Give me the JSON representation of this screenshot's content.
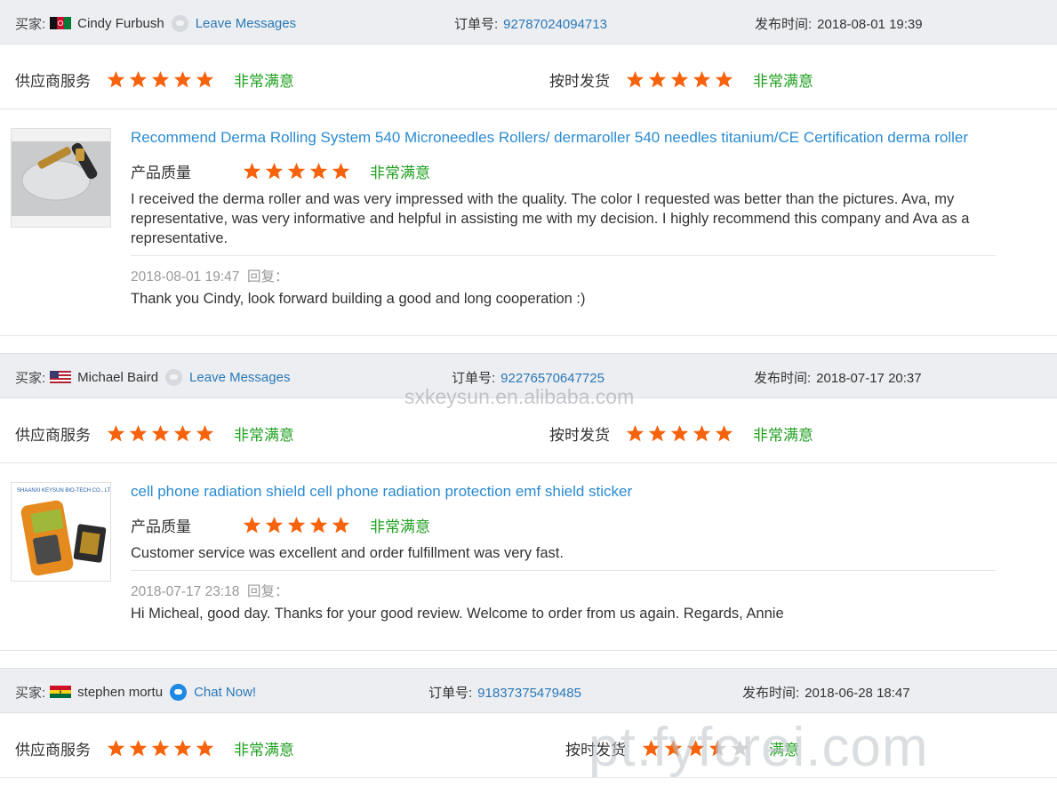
{
  "labels": {
    "buyer": "买家:",
    "order": "订单号:",
    "published": "发布时间:",
    "supplier_service": "供应商服务",
    "on_time_delivery": "按时发货",
    "product_quality": "产品质量",
    "reply": "回复：",
    "very_satisfied": "非常满意"
  },
  "colors": {
    "star": "#f7630c",
    "star_empty": "#d3d3d3",
    "link": "#2b79b8",
    "title": "#2b8bd0",
    "satisfied": "#21a021"
  },
  "reviews": [
    {
      "buyer_name": "Cindy Furbush",
      "flag": "afghanistan-flag",
      "contact_label": "Leave Messages",
      "order_no": "92787024094713",
      "published_time": "2018-08-01 19:39",
      "supplier_service_stars": 5,
      "on_time_delivery_stars": 5,
      "supplier_service_text": "非常满意",
      "on_time_delivery_text": "非常满意",
      "product_title": "Recommend Derma Rolling System 540 Microneedles Rollers/ dermaroller 540 needles titanium/CE Certification derma roller",
      "product_quality_stars": 5,
      "product_quality_text": "非常满意",
      "comment": "I received the derma roller and was very impressed with the quality. The color I requested was better than the pictures. Ava, my representative, was very informative and helpful in assisting me with my decision. I highly recommend this company and Ava as a representative.",
      "reply_time": "2018-08-01 19:47",
      "reply_text": "Thank you Cindy, look forward building a good and long cooperation :)"
    },
    {
      "buyer_name": "Michael Baird",
      "flag": "usa-flag",
      "contact_label": "Leave Messages",
      "order_no": "92276570647725",
      "published_time": "2018-07-17 20:37",
      "supplier_service_stars": 5,
      "on_time_delivery_stars": 5,
      "supplier_service_text": "非常满意",
      "on_time_delivery_text": "非常满意",
      "product_title": "cell phone radiation shield cell phone radiation protection emf shield sticker",
      "product_quality_stars": 5,
      "product_quality_text": "非常满意",
      "comment": "Customer service was excellent and order fulfillment was very fast.",
      "reply_time": "2018-07-17 23:18",
      "reply_text": "Hi Micheal, good day. Thanks for your good review. Welcome to order from us again. Regards, Annie"
    },
    {
      "buyer_name": "stephen mortu",
      "flag": "ghana-flag",
      "contact_label": "Chat Now!",
      "order_no": "91837375479485",
      "published_time": "2018-06-28 18:47",
      "supplier_service_stars": 5,
      "on_time_delivery_stars": 3.5,
      "supplier_service_text": "非常满意",
      "on_time_delivery_text": "满意"
    }
  ],
  "watermarks": [
    "sxkeysun.en.alibaba.com",
    "pt.fyfcrei.com"
  ]
}
